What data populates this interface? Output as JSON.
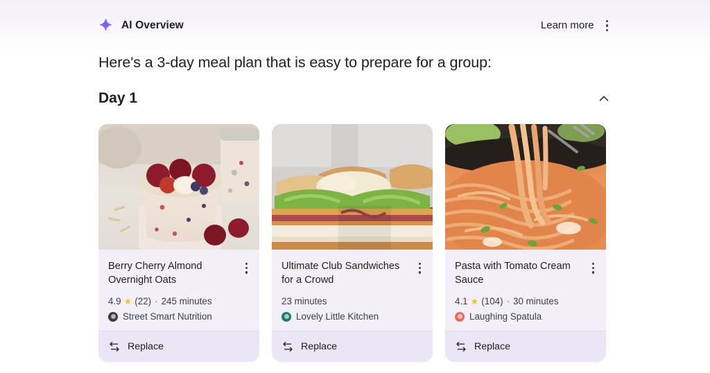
{
  "overview": {
    "icon": "sparkle-icon",
    "title": "AI Overview",
    "learn_more": "Learn more",
    "menu_icon": "more-vert-icon"
  },
  "headline": "Here's a 3-day meal plan that is easy to prepare for a group:",
  "day_section": {
    "title": "Day 1",
    "collapse_icon": "chevron-up-icon"
  },
  "replace_label": "Replace",
  "replace_icon": "swap-arrows-icon",
  "colors": {
    "card_bg": "#f3eff9",
    "footer_bg": "#ebe5f5",
    "star": "#f8c51c",
    "accent_purple": "#8b5cf6",
    "text": "#1f1f1f"
  },
  "cards": [
    {
      "title": "Berry Cherry Almond Overnight Oats",
      "rating": "4.9",
      "star_icon": "star-icon",
      "reviews": "(22)",
      "separator": "·",
      "time": "245 minutes",
      "source": "Street Smart Nutrition",
      "favicon_color": "#3a3a3c",
      "image_alt": "overnight-oats-photo",
      "menu_icon": "more-vert-icon",
      "replace_label": "Replace"
    },
    {
      "title": "Ultimate Club Sandwiches for a Crowd",
      "rating": "",
      "star_icon": "",
      "reviews": "",
      "separator": "",
      "time": "23 minutes",
      "source": "Lovely Little Kitchen",
      "favicon_color": "#1a7a6b",
      "image_alt": "club-sandwich-photo",
      "menu_icon": "more-vert-icon",
      "replace_label": "Replace"
    },
    {
      "title": "Pasta with Tomato Cream Sauce",
      "rating": "4.1",
      "star_icon": "star-icon",
      "reviews": "(104)",
      "separator": "·",
      "time": "30 minutes",
      "source": "Laughing Spatula",
      "favicon_color": "#f1685e",
      "image_alt": "pasta-tomato-cream-photo",
      "menu_icon": "more-vert-icon",
      "replace_label": "Replace"
    }
  ]
}
